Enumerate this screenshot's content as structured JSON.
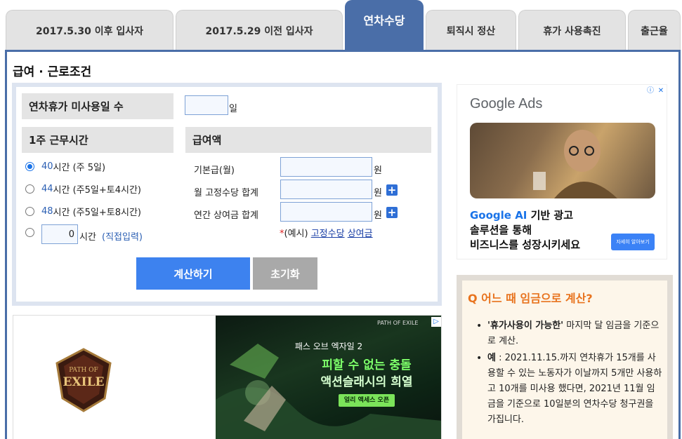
{
  "tabs": [
    {
      "label": "2017.5.30 이후 입사자"
    },
    {
      "label": "2017.5.29 이전 입사자"
    },
    {
      "label": "연차수당"
    },
    {
      "label": "퇴직시 정산"
    },
    {
      "label": "휴가 사용촉진"
    },
    {
      "label": "출근율"
    }
  ],
  "section_title": "급여 · 근로조건",
  "form": {
    "unused_leave_label": "연차휴가 미사용일 수",
    "unused_leave_value": "",
    "unused_leave_unit": "일",
    "weekly_hours_label": "1주 근무시간",
    "hours_options": [
      {
        "num": "40",
        "unit": "시간",
        "desc": "(주 5일)",
        "checked": true
      },
      {
        "num": "44",
        "unit": "시간",
        "desc": "(주5일+토4시간)",
        "checked": false
      },
      {
        "num": "48",
        "unit": "시간",
        "desc": "(주5일+토8시간)",
        "checked": false
      }
    ],
    "custom_hours_value": "0",
    "custom_hours_unit": "시간",
    "custom_hours_desc": "(직접입력)",
    "salary_label": "급여액",
    "base_pay_label": "기본급(월)",
    "fixed_allowance_label": "월 고정수당 합계",
    "annual_bonus_label": "연간 상여금 합계",
    "won_unit": "원",
    "example_star": "*",
    "example_prefix": "(예시)",
    "example_link1": "고정수당",
    "example_link2": "상여금",
    "calc_button": "계산하기",
    "reset_button": "초기화"
  },
  "ad_game": {
    "logo_text_top": "PATH OF",
    "logo_text_main": "EXILE",
    "small_top": "PATH OF EXILE",
    "line1": "패스 오브 엑자일 2",
    "line2": "피할 수 없는 충돌",
    "line3": "액션슬래시의 희열",
    "cta": "얼리 액세스 오픈"
  },
  "ad_google": {
    "logo": "Google Ads",
    "line1_ai": "Google AI",
    "line1_rest": " 기반 광고",
    "line2": "솔루션을 통해",
    "line3": "비즈니스를 성장시키세요",
    "button": "자세히 알아보기"
  },
  "qa": {
    "title": "Q 어느 때 임금으로 계산?",
    "item1_bold": "'휴가사용이 가능한'",
    "item1_rest": " 마지막 달 임금을 기준으로 계산.",
    "item2_bold": "예",
    "item2_rest": " : 2021.11.15.까지 연차휴가 15개를 사용할 수 있는 노동자가 이날까지 5개만 사용하고 10개를 미사용 했다면, 2021년 11월 임금을 기준으로 10일분의 연차수당 청구권을 가집니다."
  },
  "colors": {
    "tab_active": "#4a6ea8",
    "primary_button": "#3d82ef",
    "reset_button": "#a9a9a9",
    "qa_title": "#e8731e"
  }
}
